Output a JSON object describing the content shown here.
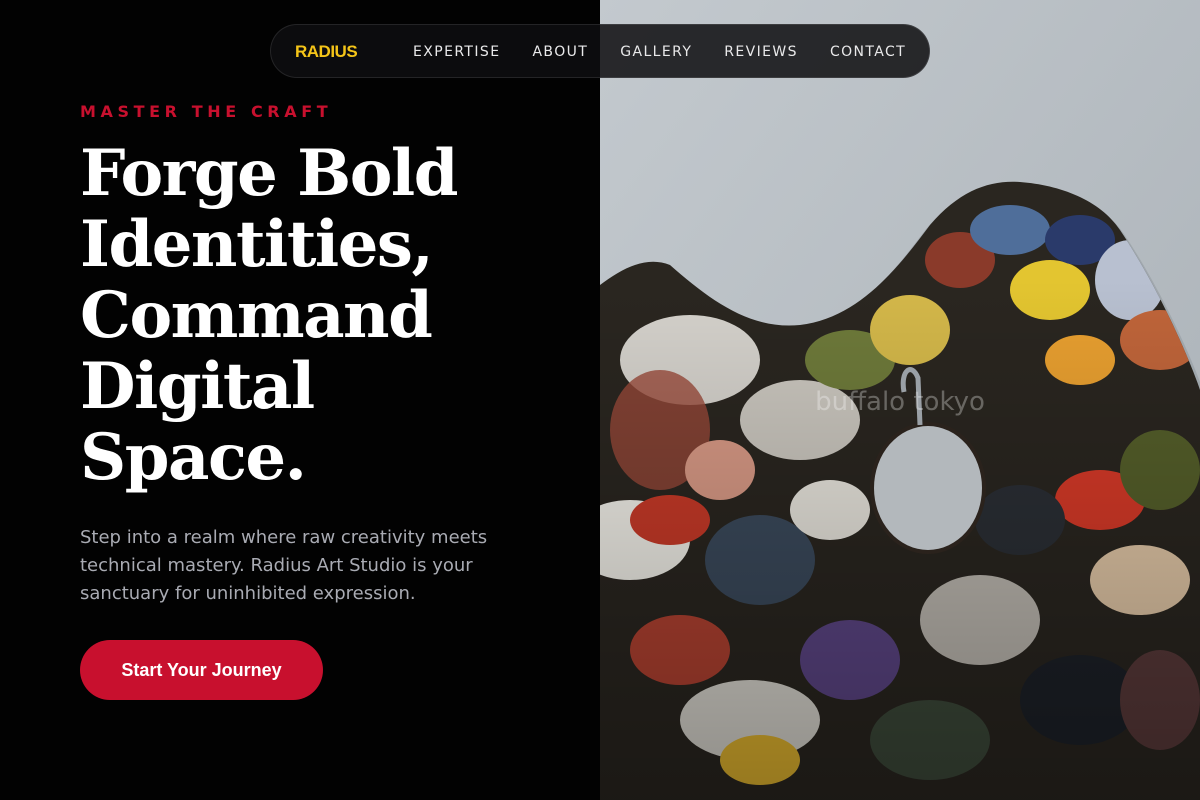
{
  "theme": {
    "accent_red": "#c8102e",
    "brand_gold": "#f5c518",
    "background": "#020202",
    "text_muted": "#a9abb3"
  },
  "nav": {
    "brand": "RADIUS",
    "links": [
      "EXPERTISE",
      "ABOUT",
      "GALLERY",
      "REVIEWS",
      "CONTACT"
    ]
  },
  "hero": {
    "eyebrow": "MASTER THE CRAFT",
    "headline_lines": [
      "Forge Bold",
      "Identities,",
      "Command",
      "Digital",
      "Space."
    ],
    "subtext": "Step into a realm where raw creativity meets technical mastery. Radius Art Studio is your sanctuary for uninhibited expression.",
    "cta_label": "Start Your Journey"
  },
  "image": {
    "subject": "paint-palette-photo",
    "watermark": "buffalo tokyo"
  }
}
